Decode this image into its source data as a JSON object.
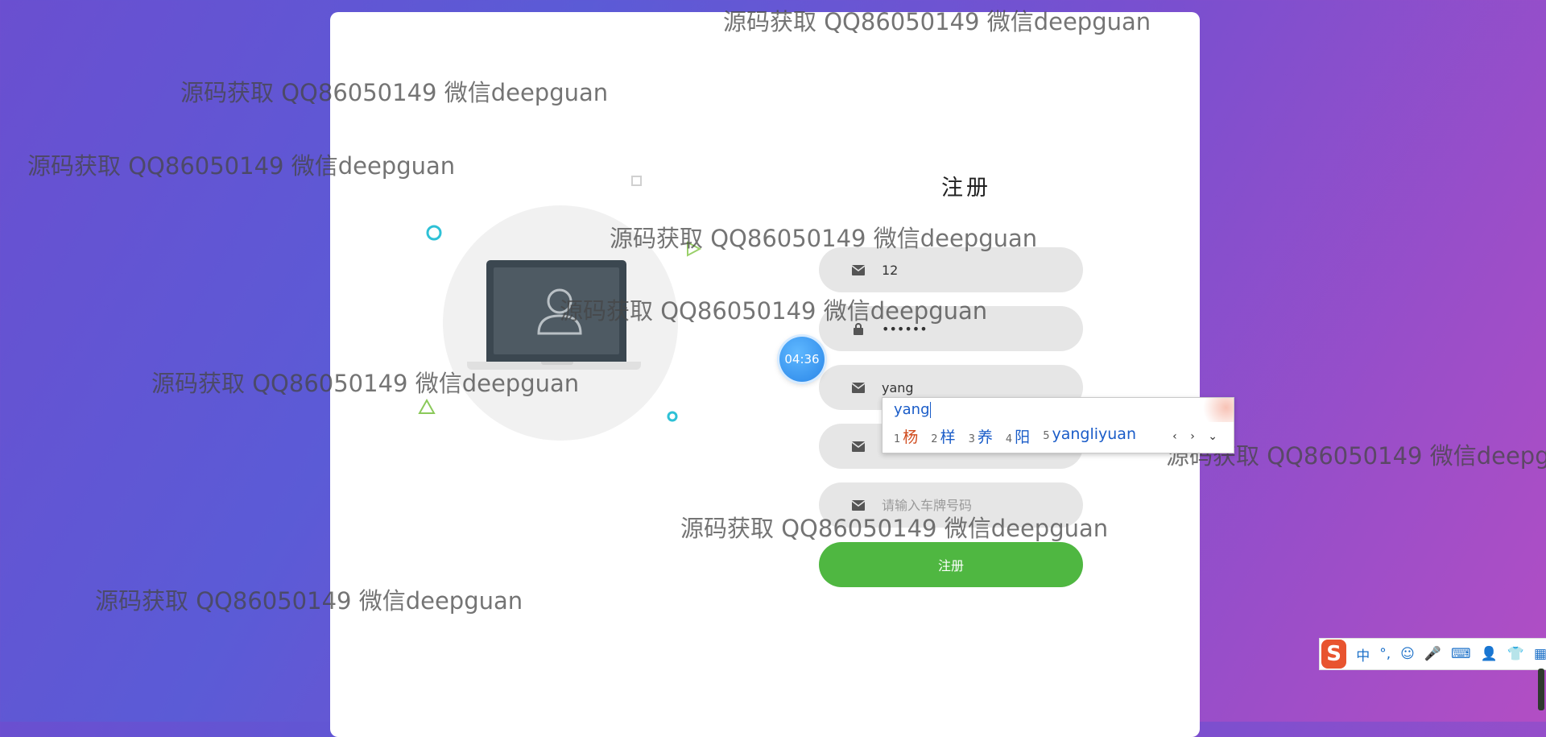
{
  "form": {
    "title": "注册",
    "fields": [
      {
        "icon": "envelope-icon",
        "value": "12",
        "placeholder": "",
        "type": "text"
      },
      {
        "icon": "lock-icon",
        "value": "••••••",
        "placeholder": "",
        "type": "password"
      },
      {
        "icon": "envelope-icon",
        "value": "yang",
        "placeholder": "",
        "type": "text"
      },
      {
        "icon": "envelope-icon",
        "value": "",
        "placeholder": "",
        "type": "text"
      },
      {
        "icon": "envelope-icon",
        "value": "",
        "placeholder": "请输入车牌号码",
        "type": "text"
      }
    ],
    "submit_label": "注册"
  },
  "timer": {
    "label": "04:36"
  },
  "ime_popup": {
    "composition": "yang",
    "candidates": [
      {
        "num": "1",
        "text": "杨"
      },
      {
        "num": "2",
        "text": "样"
      },
      {
        "num": "3",
        "text": "养"
      },
      {
        "num": "4",
        "text": "阳"
      },
      {
        "num": "5",
        "text": "yangliyuan"
      }
    ],
    "nav": "‹ › ⌄"
  },
  "ime_toolbar": {
    "logo": "S",
    "items": [
      "中",
      "°,",
      "☺",
      "🎤",
      "⌨",
      "👤",
      "👕",
      "▦"
    ]
  },
  "watermark": {
    "text": "源码获取 QQ86050149 微信deepguan",
    "text_cut": "源码获取 QQ86050149 微信deepg"
  },
  "colors": {
    "submit": "#4fb741",
    "field_bg": "#e6e6e6",
    "timer": "#2a86e8",
    "card": "#ffffff"
  }
}
